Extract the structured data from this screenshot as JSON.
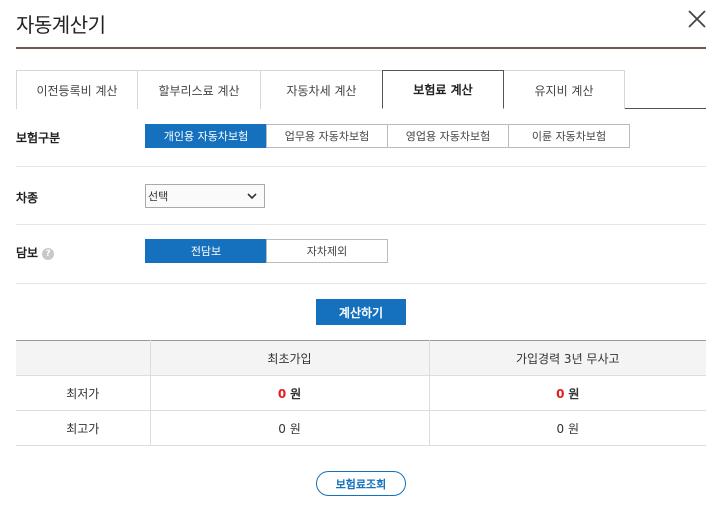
{
  "dialog": {
    "title": "자동계산기",
    "close_icon": "close-icon"
  },
  "tabs": [
    {
      "label": "이전등록비 계산",
      "active": false
    },
    {
      "label": "할부리스료 계산",
      "active": false
    },
    {
      "label": "자동차세 계산",
      "active": false
    },
    {
      "label": "보험료 계산",
      "active": true
    },
    {
      "label": "유지비 계산",
      "active": false
    }
  ],
  "insurance_type": {
    "label": "보험구분",
    "options": [
      "개인용 자동차보험",
      "업무용 자동차보험",
      "영업용 자동차보험",
      "이륜 자동차보험"
    ],
    "selected": "개인용 자동차보험"
  },
  "vehicle_type": {
    "label": "차종",
    "selected": "선택"
  },
  "coverage": {
    "label": "담보",
    "help_icon": "question-icon",
    "help_glyph": "?",
    "options": [
      "전담보",
      "자차제외"
    ],
    "selected": "전담보"
  },
  "calculate_button": "계산하기",
  "result_table": {
    "headers": [
      "",
      "최초가입",
      "가입경력 3년 무사고"
    ],
    "rows": [
      {
        "label": "최저가",
        "first": "0",
        "experienced": "0",
        "unit": "원"
      },
      {
        "label": "최고가",
        "first": "0",
        "experienced": "0",
        "unit": "원"
      }
    ]
  },
  "lookup_button": "보험료조회",
  "colors": {
    "accent": "#1571bd",
    "highlight": "#e02020",
    "title_rule": "#6e5b4f"
  }
}
